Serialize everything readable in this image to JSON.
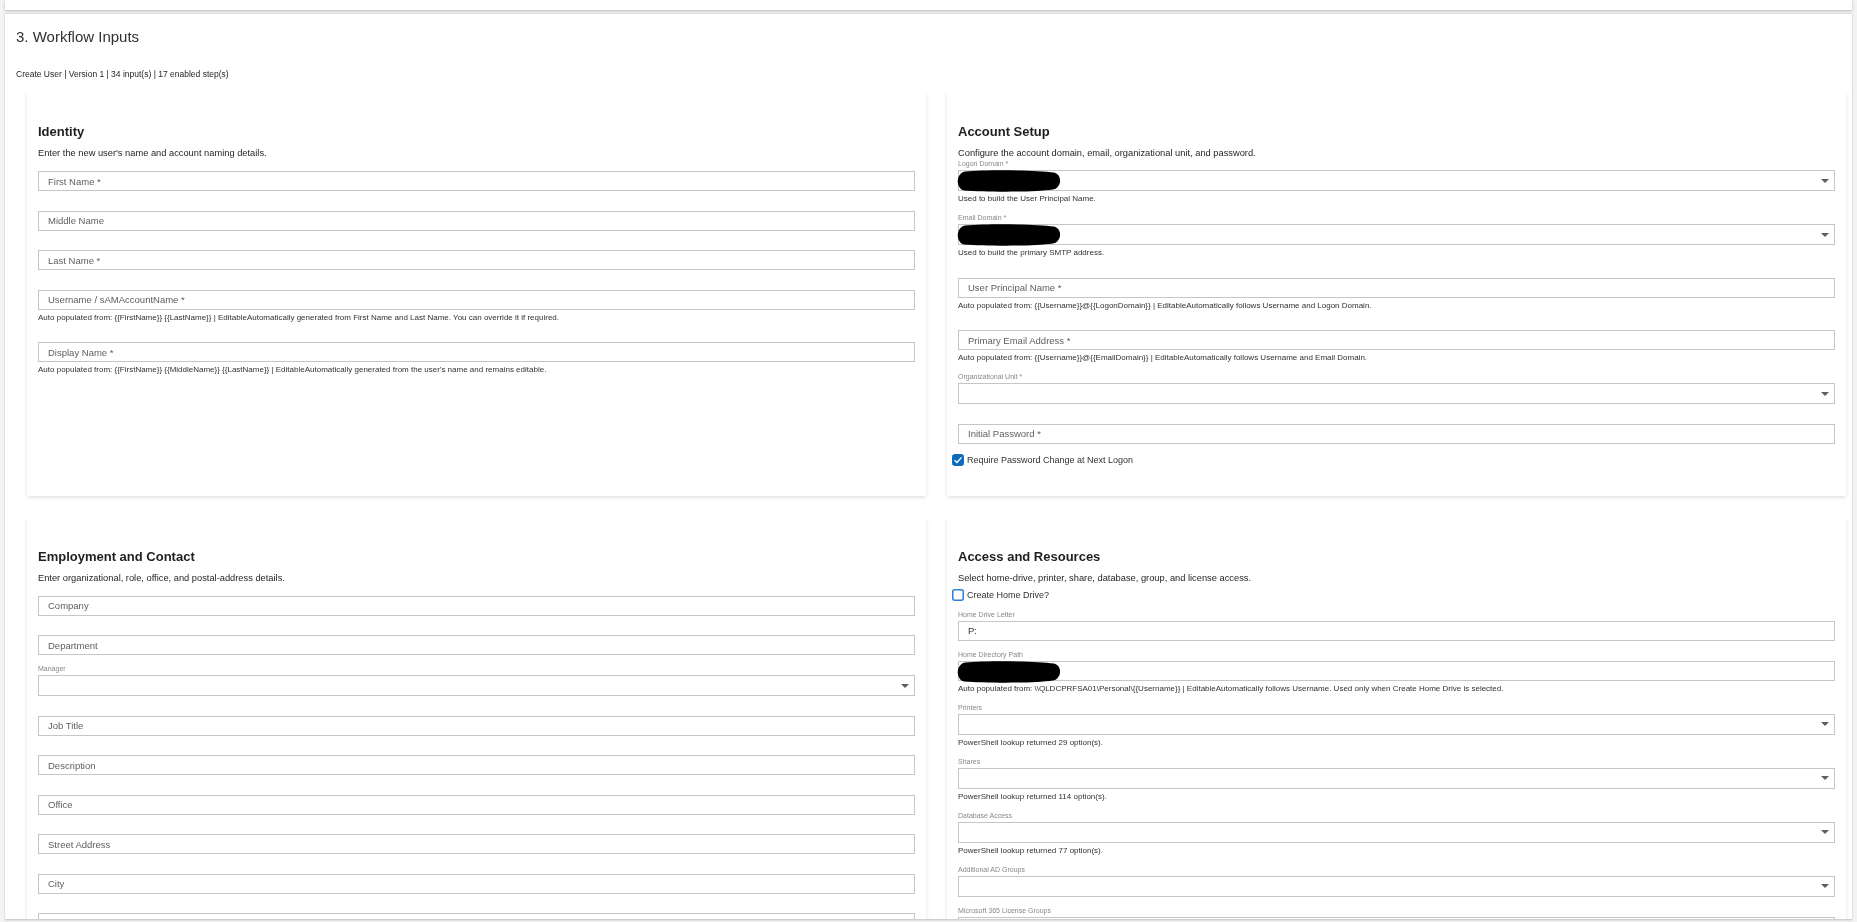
{
  "page": {
    "title": "3. Workflow Inputs",
    "summary": "Create User | Version 1 | 34 input(s) | 17 enabled step(s)"
  },
  "sections": [
    {
      "title": "Identity",
      "description": "Enter the new user's name and account naming details.",
      "fields": [
        {
          "kind": "input",
          "placeholder": "First Name *"
        },
        {
          "kind": "input",
          "placeholder": "Middle Name"
        },
        {
          "kind": "input",
          "placeholder": "Last Name *"
        },
        {
          "kind": "input",
          "placeholder": "Username / sAMAccountName *",
          "helper": "Auto populated from: {{FirstName}} {{LastName}} | EditableAutomatically generated from First Name and Last Name. You can override it if required."
        },
        {
          "kind": "input",
          "placeholder": "Display Name *",
          "helper": "Auto populated from: {{FirstName}} {{MiddleName}} {{LastName}} | EditableAutomatically generated from the user's name and remains editable."
        }
      ]
    },
    {
      "title": "Account Setup",
      "description": "Configure the account domain, email, organizational unit, and password.",
      "fields": [
        {
          "kind": "select",
          "label": "Logon Domain *",
          "helper": "Used to build the User Principal Name.",
          "redacted": true
        },
        {
          "kind": "select",
          "label": "Email Domain *",
          "helper": "Used to build the primary SMTP address.",
          "redacted": true
        },
        {
          "kind": "input",
          "placeholder": "User Principal Name *",
          "helper": "Auto populated from: {{Username}}@{{LogonDomain}} | EditableAutomatically follows Username and Logon Domain."
        },
        {
          "kind": "input",
          "placeholder": "Primary Email Address *",
          "helper": "Auto populated from: {{Username}}@{{EmailDomain}} | EditableAutomatically follows Username and Email Domain."
        },
        {
          "kind": "select",
          "label": "Organizational Unit *"
        },
        {
          "kind": "input",
          "placeholder": "Initial Password *"
        },
        {
          "kind": "checkbox",
          "label": "Require Password Change at Next Logon",
          "checked": true
        }
      ]
    },
    {
      "title": "Employment and Contact",
      "description": "Enter organizational, role, office, and postal-address details.",
      "fields": [
        {
          "kind": "input",
          "placeholder": "Company"
        },
        {
          "kind": "input",
          "placeholder": "Department"
        },
        {
          "kind": "select",
          "label": "Manager"
        },
        {
          "kind": "input",
          "placeholder": "Job Title"
        },
        {
          "kind": "input",
          "placeholder": "Description"
        },
        {
          "kind": "input",
          "placeholder": "Office"
        },
        {
          "kind": "input",
          "placeholder": "Street Address"
        },
        {
          "kind": "input",
          "placeholder": "City"
        },
        {
          "kind": "input"
        }
      ]
    },
    {
      "title": "Access and Resources",
      "description": "Select home-drive, printer, share, database, group, and license access.",
      "fields": [
        {
          "kind": "checkbox",
          "label": "Create Home Drive?",
          "checked": false
        },
        {
          "kind": "input",
          "label": "Home Drive Letter",
          "value": "P:"
        },
        {
          "kind": "input",
          "label": "Home Directory Path",
          "helper": "Auto populated from: \\\\QLDCPRFSA01\\Personal\\{{Username}} | EditableAutomatically follows Username. Used only when Create Home Drive is selected.",
          "redacted": true
        },
        {
          "kind": "select",
          "label": "Printers",
          "helper": "PowerShell lookup returned 29 option(s)."
        },
        {
          "kind": "select",
          "label": "Shares",
          "helper": "PowerShell lookup returned 114 option(s)."
        },
        {
          "kind": "select",
          "label": "Database Access",
          "helper": "PowerShell lookup returned 77 option(s)."
        },
        {
          "kind": "select",
          "label": "Additional AD Groups"
        },
        {
          "kind": "select",
          "label": "Microsoft 365 License Groups"
        }
      ]
    }
  ]
}
